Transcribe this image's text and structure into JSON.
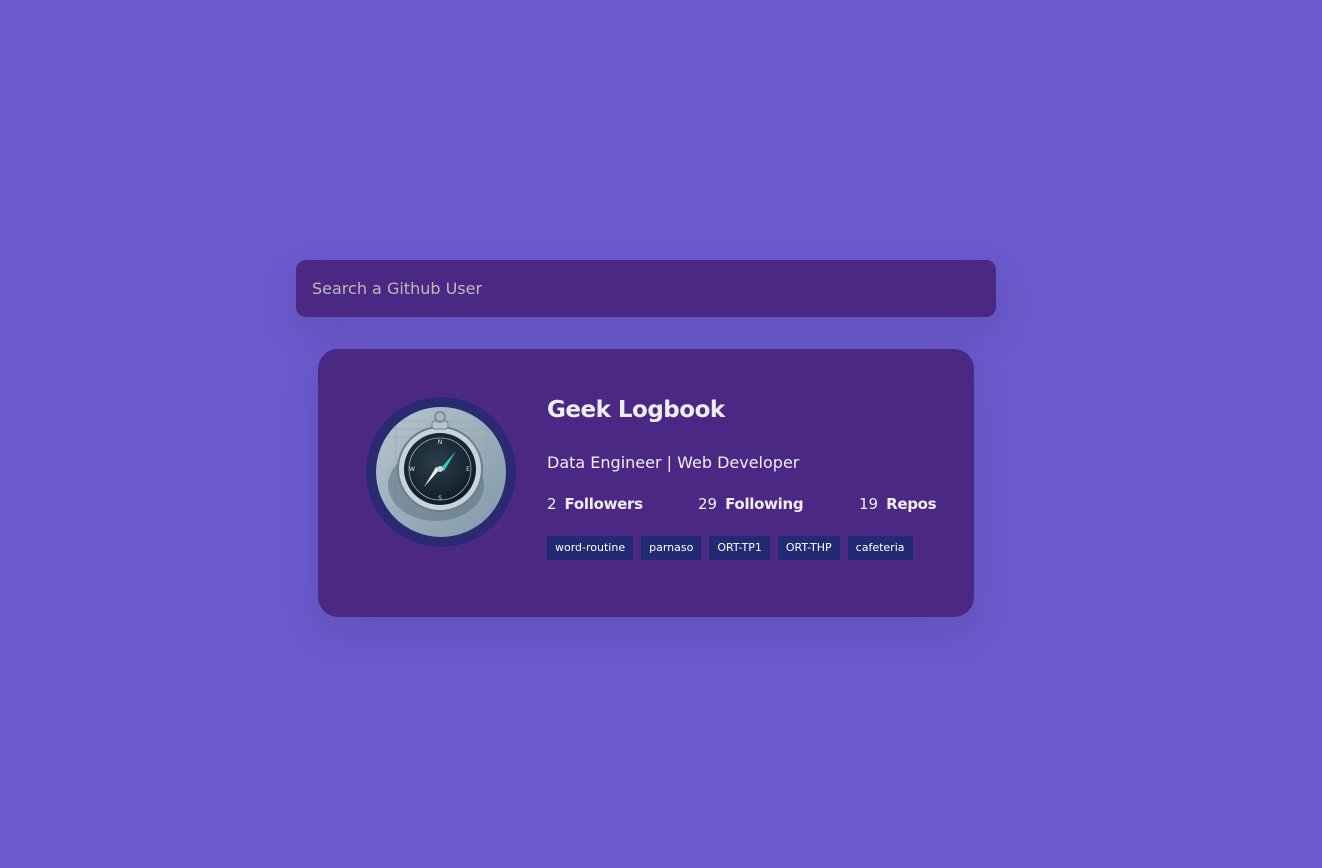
{
  "search": {
    "placeholder": "Search a Github User",
    "value": ""
  },
  "profile": {
    "name": "Geek Logbook",
    "bio": "Data Engineer | Web Developer",
    "avatar_icon": "compass-avatar-image",
    "stats": [
      {
        "count": "2",
        "label": "Followers"
      },
      {
        "count": "29",
        "label": "Following"
      },
      {
        "count": "19",
        "label": "Repos"
      }
    ],
    "repos": [
      "word-routine",
      "parnaso",
      "ORT-TP1",
      "ORT-THP",
      "cafeteria"
    ]
  },
  "colors": {
    "background": "#6a5acd",
    "card": "#4c2885",
    "avatar_ring": "#2a2a72",
    "repo_tag": "#212a72",
    "text": "#eeeeee"
  }
}
